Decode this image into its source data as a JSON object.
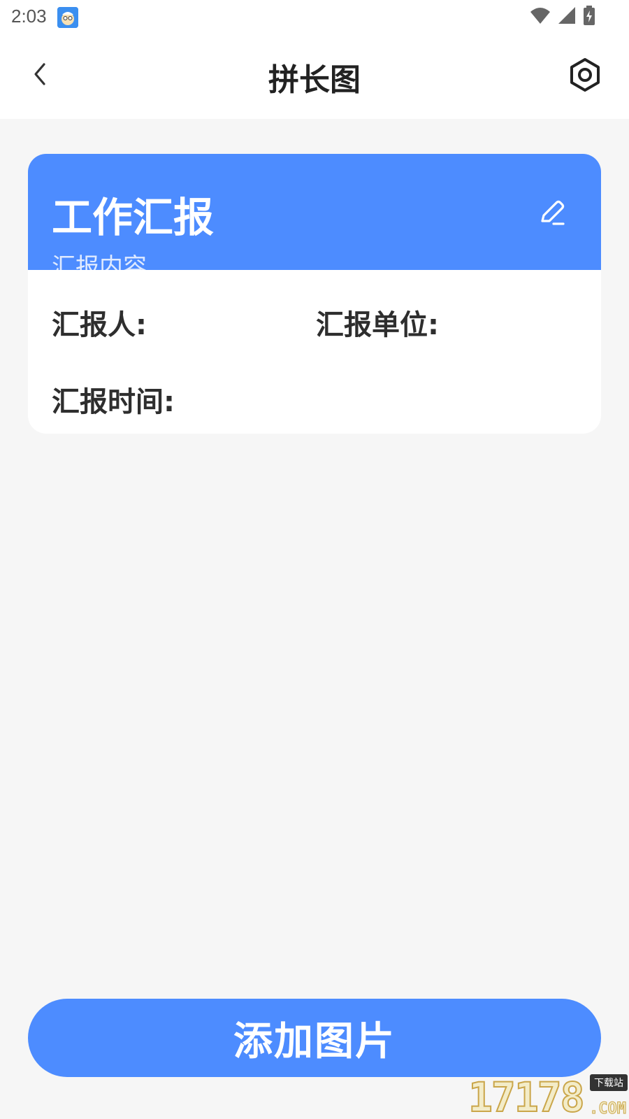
{
  "status_bar": {
    "time": "2:03",
    "icons": [
      "app-avatar-icon",
      "wifi-icon",
      "cellular-signal-icon",
      "battery-charging-icon"
    ]
  },
  "header": {
    "title": "拼长图",
    "back_icon": "chevron-left-icon",
    "settings_icon": "hexagon-settings-icon"
  },
  "card": {
    "title": "工作汇报",
    "subtitle": "汇报内容",
    "edit_icon": "pencil-edit-icon",
    "reporter_label": "汇报人:",
    "unit_label": "汇报单位:",
    "time_label": "汇报时间:"
  },
  "footer": {
    "add_button_label": "添加图片"
  },
  "watermark": {
    "number": "17178",
    "tag": "下载站",
    "suffix": ".COM"
  },
  "colors": {
    "accent": "#4d8cff",
    "page_background": "#f6f6f6",
    "card_background": "#ffffff",
    "text_primary": "#222222"
  }
}
